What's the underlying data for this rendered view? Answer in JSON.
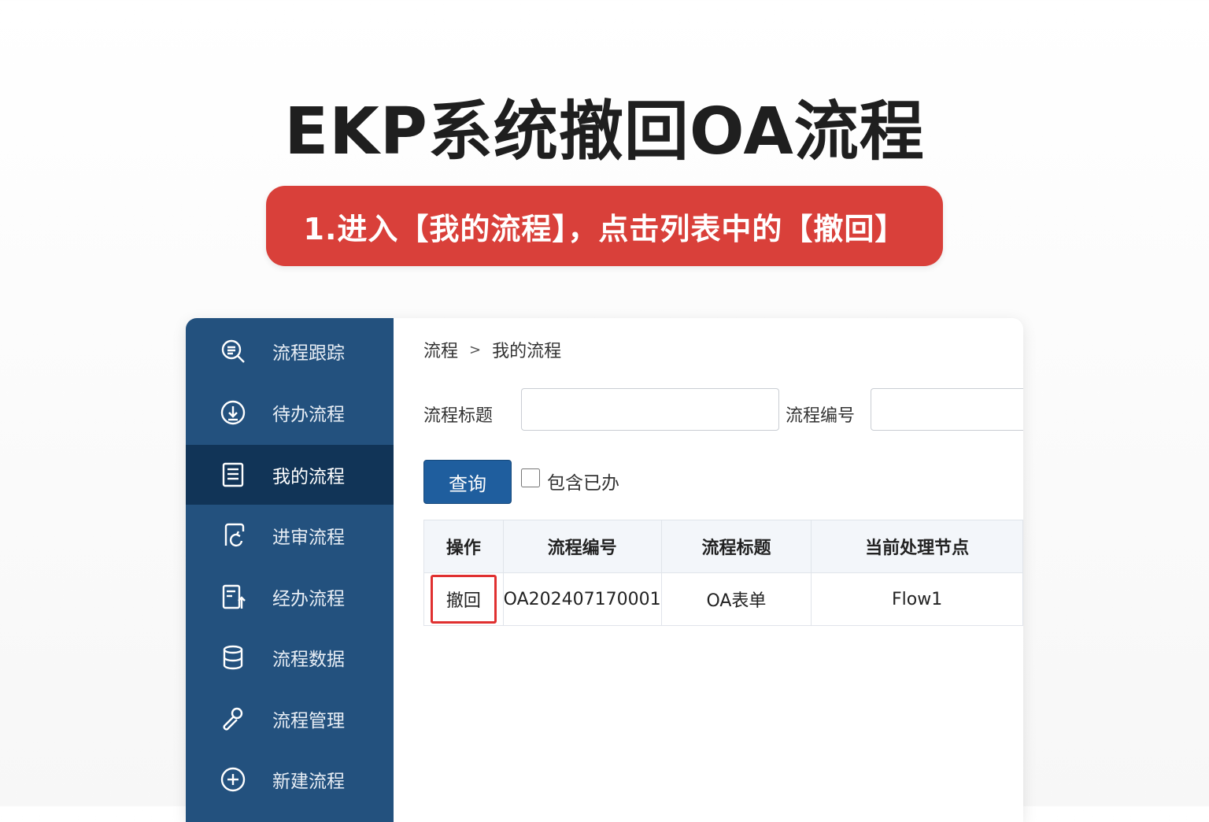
{
  "title": "EKP系统撤回OA流程",
  "banner": "1.进入【我的流程】，点击列表中的【撤回】",
  "sidebar": {
    "items": [
      {
        "label": "流程跟踪",
        "icon": "search-list-icon"
      },
      {
        "label": "待办流程",
        "icon": "download-circle-icon"
      },
      {
        "label": "我的流程",
        "icon": "document-list-icon",
        "active": true
      },
      {
        "label": "进审流程",
        "icon": "refresh-doc-icon"
      },
      {
        "label": "经办流程",
        "icon": "upload-doc-icon"
      },
      {
        "label": "流程数据",
        "icon": "database-icon"
      },
      {
        "label": "流程管理",
        "icon": "wrench-icon"
      },
      {
        "label": "新建流程",
        "icon": "plus-circle-icon"
      }
    ]
  },
  "breadcrumb": {
    "root": "流程",
    "separator": ">",
    "current": "我的流程"
  },
  "filters": {
    "title_label": "流程标题",
    "title_value": "",
    "number_label": "流程编号",
    "number_value": ""
  },
  "query_button": "查询",
  "include_done_label": "包含已办",
  "table": {
    "headers": [
      "操作",
      "流程编号",
      "流程标题",
      "当前处理节点"
    ],
    "rows": [
      {
        "action": "撤回",
        "number": "OA202407170001",
        "title": "OA表单",
        "node": "Flow1"
      }
    ]
  },
  "colors": {
    "sidebar": "#23517e",
    "sidebar_active": "#113457",
    "banner": "#d9403a",
    "highlight": "#e03030",
    "button": "#1f5e9e"
  }
}
